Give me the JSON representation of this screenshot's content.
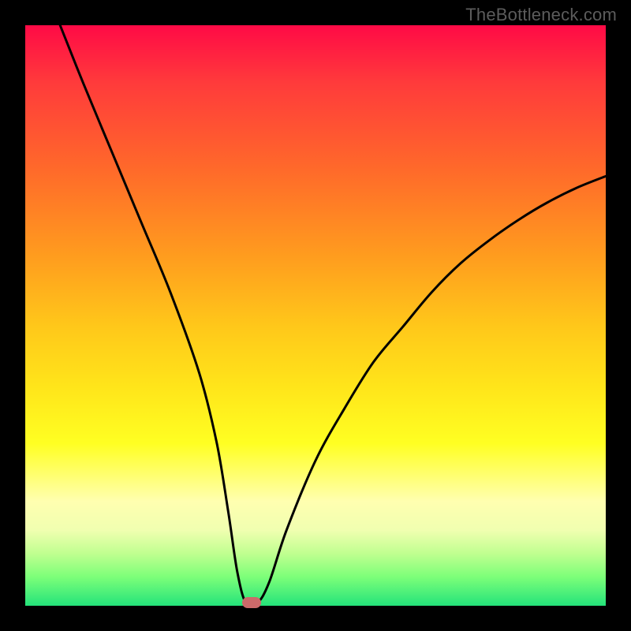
{
  "watermark": "TheBottleneck.com",
  "chart_data": {
    "type": "line",
    "title": "",
    "xlabel": "",
    "ylabel": "",
    "xlim": [
      0,
      100
    ],
    "ylim": [
      0,
      100
    ],
    "series": [
      {
        "name": "bottleneck-curve",
        "x": [
          6,
          10,
          15,
          20,
          25,
          30,
          33,
          35,
          36.5,
          38,
          40,
          42,
          45,
          50,
          55,
          60,
          65,
          70,
          75,
          80,
          85,
          90,
          95,
          100
        ],
        "values": [
          100,
          90,
          78,
          66,
          54,
          40,
          28,
          16,
          6,
          0.5,
          0.5,
          4,
          13,
          25,
          34,
          42,
          48,
          54,
          59,
          63,
          66.5,
          69.5,
          72,
          74
        ]
      }
    ],
    "marker": {
      "x": 39,
      "y": 0.5,
      "color": "#cc6a6a"
    },
    "gradient_stops": [
      {
        "pos": 0,
        "color": "#ff0a46"
      },
      {
        "pos": 10,
        "color": "#ff3b3b"
      },
      {
        "pos": 25,
        "color": "#ff6a2a"
      },
      {
        "pos": 40,
        "color": "#ff9d1e"
      },
      {
        "pos": 52,
        "color": "#ffc81a"
      },
      {
        "pos": 62,
        "color": "#ffe41a"
      },
      {
        "pos": 72,
        "color": "#ffff22"
      },
      {
        "pos": 82,
        "color": "#ffffb0"
      },
      {
        "pos": 87,
        "color": "#f0ffb0"
      },
      {
        "pos": 91,
        "color": "#c0ff90"
      },
      {
        "pos": 95,
        "color": "#7dff79"
      },
      {
        "pos": 100,
        "color": "#24e37a"
      }
    ]
  }
}
